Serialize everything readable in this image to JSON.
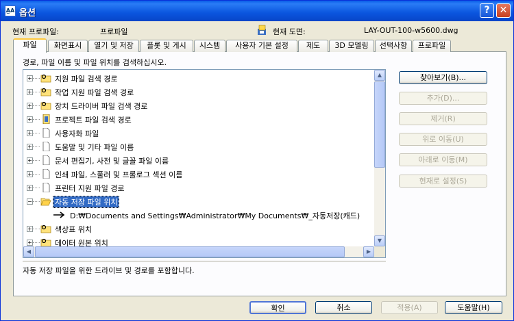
{
  "window": {
    "title": "옵션",
    "app_icon": "autocad-options-icon"
  },
  "titlebar_buttons": {
    "help": "?",
    "close": "✕"
  },
  "header": {
    "profile_label": "현재 프로파일:",
    "profile_value": "프로파일",
    "drawing_label": "현재 도면:",
    "drawing_value": "LAY-OUT-100-w5600.dwg"
  },
  "tabs": [
    "파일",
    "화면표시",
    "열기 및 저장",
    "플롯 및 게시",
    "시스템",
    "사용자 기본 설정",
    "제도",
    "3D 모델링",
    "선택사항",
    "프로파일"
  ],
  "active_tab": 0,
  "tree": {
    "instruction": "경로, 파일 이름 및 파일 위치를 검색하십시오.",
    "items": [
      {
        "label": "지원 파일 검색 경로",
        "icon": "folder-search-icon",
        "expander": "+"
      },
      {
        "label": "작업 지원 파일 검색 경로",
        "icon": "folder-search-icon",
        "expander": "+"
      },
      {
        "label": "장치 드라이버 파일 검색 경로",
        "icon": "folder-search-icon",
        "expander": "+"
      },
      {
        "label": "프로젝트 파일 검색 경로",
        "icon": "project-file-icon",
        "expander": "+"
      },
      {
        "label": "사용자화 파일",
        "icon": "document-icon",
        "expander": "+"
      },
      {
        "label": "도움말 및 기타 파일 이름",
        "icon": "document-icon",
        "expander": "+"
      },
      {
        "label": "문서 편집기, 사전 및 글꼴 파일 이름",
        "icon": "document-icon",
        "expander": "+"
      },
      {
        "label": "인쇄 파일, 스풀러 및 프롤로그 섹션 이름",
        "icon": "document-icon",
        "expander": "+"
      },
      {
        "label": "프린터 지원 파일 경로",
        "icon": "document-icon",
        "expander": "+"
      },
      {
        "label": "자동 저장 파일 위치",
        "icon": "folder-open-icon",
        "expander": "−",
        "selected": true
      },
      {
        "label": "D:₩Documents and Settings₩Administrator₩My Documents₩_자동저장(캐드)",
        "icon": "arrow-right-icon",
        "child": true
      },
      {
        "label": "색상표 위치",
        "icon": "folder-search-icon",
        "expander": "+"
      },
      {
        "label": "데이터 원본 위치",
        "icon": "folder-search-icon",
        "expander": "+"
      }
    ]
  },
  "description": "자동 저장 파일을 위한 드라이브 및 경로를 포함합니다.",
  "side_buttons": {
    "browse": "찾아보기(B)...",
    "add": "추가(D)...",
    "remove": "제거(R)",
    "move_up": "위로 이동(U)",
    "move_down": "아래로 이동(M)",
    "set_current": "현재로 설정(S)"
  },
  "footer_buttons": {
    "ok": "확인",
    "cancel": "취소",
    "apply": "적용(A)",
    "help": "도움말(H)"
  }
}
